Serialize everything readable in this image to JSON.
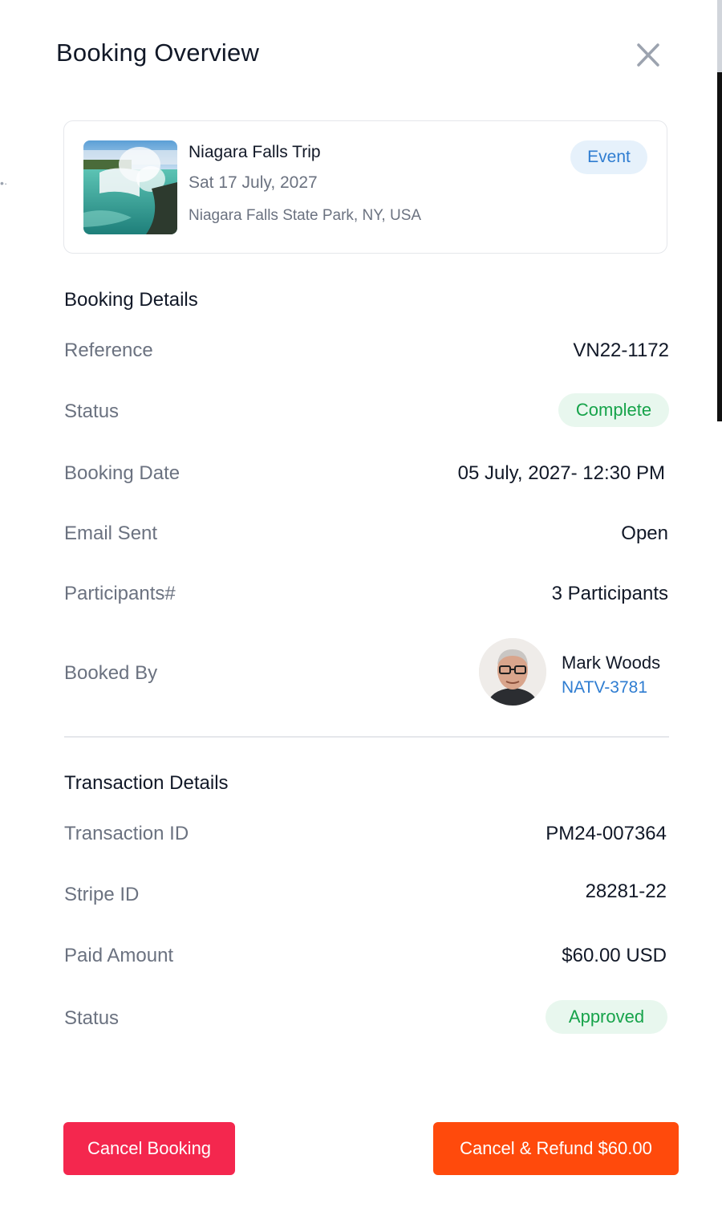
{
  "header": {
    "title": "Booking Overview",
    "close_icon": "close-icon"
  },
  "event": {
    "name": "Niagara Falls Trip",
    "date": "Sat 17 July, 2027",
    "location": "Niagara Falls State Park, NY, USA",
    "badge": "Event",
    "image_icon": "waterfall-photo"
  },
  "booking": {
    "section_title": "Booking Details",
    "reference_label": "Reference",
    "reference_value": "VN22-1172",
    "status_label": "Status",
    "status_value": "Complete",
    "date_label": "Booking Date",
    "date_value": "05 July, 2027- 12:30 PM",
    "email_label": "Email Sent",
    "email_value": "Open",
    "participants_label": "Participants#",
    "participants_value": "3 Participants",
    "booked_by_label": "Booked By",
    "booked_by_name": "Mark Woods",
    "booked_by_id": "NATV-3781"
  },
  "transaction": {
    "section_title": "Transaction Details",
    "id_label": "Transaction ID",
    "id_value": "PM24-007364",
    "stripe_label": "Stripe ID",
    "stripe_value": "28281-22",
    "amount_label": "Paid Amount",
    "amount_value": "$60.00 USD",
    "status_label": "Status",
    "status_value": "Approved"
  },
  "actions": {
    "cancel_label": "Cancel Booking",
    "refund_label": "Cancel & Refund $60.00"
  },
  "colors": {
    "accent_blue": "#2f7dd1",
    "success_green": "#16a34a",
    "success_bg": "#e8f7ee",
    "cancel_red": "#f4274e",
    "refund_orange": "#ff4a0c"
  }
}
